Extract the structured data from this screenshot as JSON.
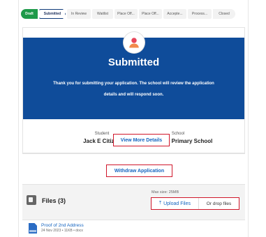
{
  "stepper": {
    "steps": [
      {
        "label": "Draft",
        "state": "done"
      },
      {
        "label": "Submitted",
        "state": "current"
      },
      {
        "label": "In Review",
        "state": "pending"
      },
      {
        "label": "Waitlist",
        "state": "pending"
      },
      {
        "label": "Place Off...",
        "state": "pending"
      },
      {
        "label": "Place Off...",
        "state": "pending"
      },
      {
        "label": "Accepte...",
        "state": "pending"
      },
      {
        "label": "Process...",
        "state": "pending"
      },
      {
        "label": "Closed",
        "state": "pending"
      }
    ]
  },
  "status": {
    "title": "Submitted",
    "message": "Thank you for submitting your application. The school will review the application details and will respond soon.",
    "avatar_icon": "user-icon"
  },
  "details": {
    "student_label": "Student",
    "student_value": "Jack E Citizen",
    "school_label": "School",
    "school_value": "Strathaird Primary School",
    "view_more_label": "View More Details"
  },
  "actions": {
    "withdraw_label": "Withdraw Application"
  },
  "files": {
    "title": "Files (3)",
    "max_size": "Max size: 25MB",
    "upload_label": "Upload Files",
    "drop_label": "Or drop files",
    "items": [
      {
        "name": "Proof of 2nd Address",
        "meta": "24 Nov 2023 • 11KB • docx",
        "icon": "doc-icon"
      }
    ]
  },
  "colors": {
    "banner": "#0f4c9a",
    "done_step": "#1f9a4a",
    "highlight": "#d0162a",
    "link": "#1565c0"
  }
}
